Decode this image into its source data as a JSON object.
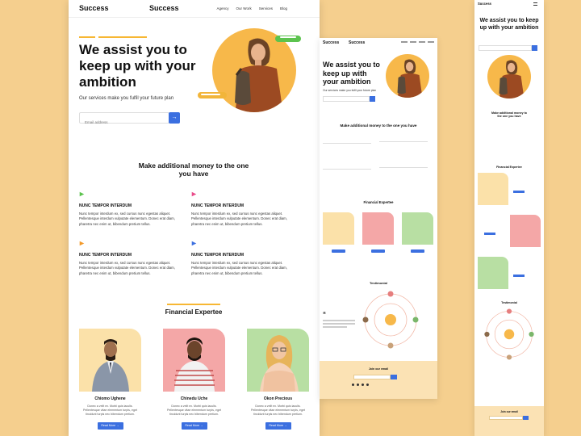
{
  "desktop": {
    "logo_left": "Success",
    "logo_center": "Success",
    "nav": [
      "Agency",
      "Our Work",
      "Services",
      "Blog"
    ],
    "hero": {
      "title": "We assist you to keep up with your ambition",
      "subtitle": "Our services make you fulfil your future plan",
      "email_placeholder": "Email address",
      "submit_icon": "arrow-right-icon"
    },
    "features_title": "Make additional  money to the one you have",
    "features": [
      {
        "icon": "play-icon",
        "color": "#5cc34e",
        "heading": "NUNC TEMPOR INTERDUM",
        "body": "Nunc tempor interdum ex, sed cursus nunc egestas aliquet. Pellentesque interdum vulputate elementum. Donec erat diam, pharetra nec enim ut, bibendum pretium tellus."
      },
      {
        "icon": "play-icon",
        "color": "#e94c8a",
        "heading": "NUNC TEMPOR INTERDUM",
        "body": "Nunc tempor interdum ex, sed cursus nunc egestas aliquet. Pellentesque interdum vulputate elementum. Donec erat diam, pharetra nec enim ut, bibendum pretium tellus."
      },
      {
        "icon": "play-icon",
        "color": "#f39a2a",
        "heading": "NUNC TEMPOR INTERDUM",
        "body": "Nunc tempor interdum ex, sed cursus nunc egestas aliquet. Pellentesque interdum vulputate elementum. Donec erat diam, pharetra nec enim ut, bibendum pretium tellus."
      },
      {
        "icon": "play-icon",
        "color": "#3b6fe0",
        "heading": "NUNC TEMPOR INTERDUM",
        "body": "Nunc tempor interdum ex, sed cursus nunc egestas aliquet. Pellentesque interdum vulputate elementum. Donec erat diam, pharetra nec enim ut, bibendum pretium tellus."
      }
    ],
    "experts_title": "Financial Expertee",
    "experts": [
      {
        "name": "Chiomo Ughene",
        "bg": "#fbe1a9",
        "desc": "Donec a velit ex. Morbi quis iaculis. Pellentesque vitae elementum turpis, eget tincidunt turpis nec bibendum pretium.",
        "button": "Read More →"
      },
      {
        "name": "Chinedu Uche",
        "bg": "#f4a7a7",
        "desc": "Donec a velit ex. Morbi quis iaculis. Pellentesque vitae elementum turpis, eget tincidunt turpis nec bibendum pretium.",
        "button": "Read More →"
      },
      {
        "name": "Okon Precious",
        "bg": "#b8dfa3",
        "desc": "Donec a velit ex. Morbi quis iaculis. Pellentesque vitae elementum turpis, eget tincidunt turpis nec bibendum pretium.",
        "button": "Read More →"
      }
    ]
  },
  "tablet": {
    "logo_left": "Success",
    "logo_center": "Success",
    "hero_title": "We assist you to keep up with your ambition",
    "hero_subtitle": "Our services make you fulfil your future plan",
    "features_title": "Make additional  money to the one you have",
    "experts_title": "Financial Expertee",
    "testimonial_title": "Testimonial",
    "newsletter_title": "Join our email"
  },
  "mobile": {
    "logo": "Success",
    "hero_title": "We assist you to keep up with your ambition",
    "features_title": "Make additional  money to the one you have",
    "experts_title": "Financial Expertee",
    "testimonial_title": "Testimonial",
    "newsletter_title": "Join our email"
  },
  "colors": {
    "accent": "#3b6fe0",
    "hero_circle": "#f7b84a",
    "background": "#f5cf8e"
  }
}
